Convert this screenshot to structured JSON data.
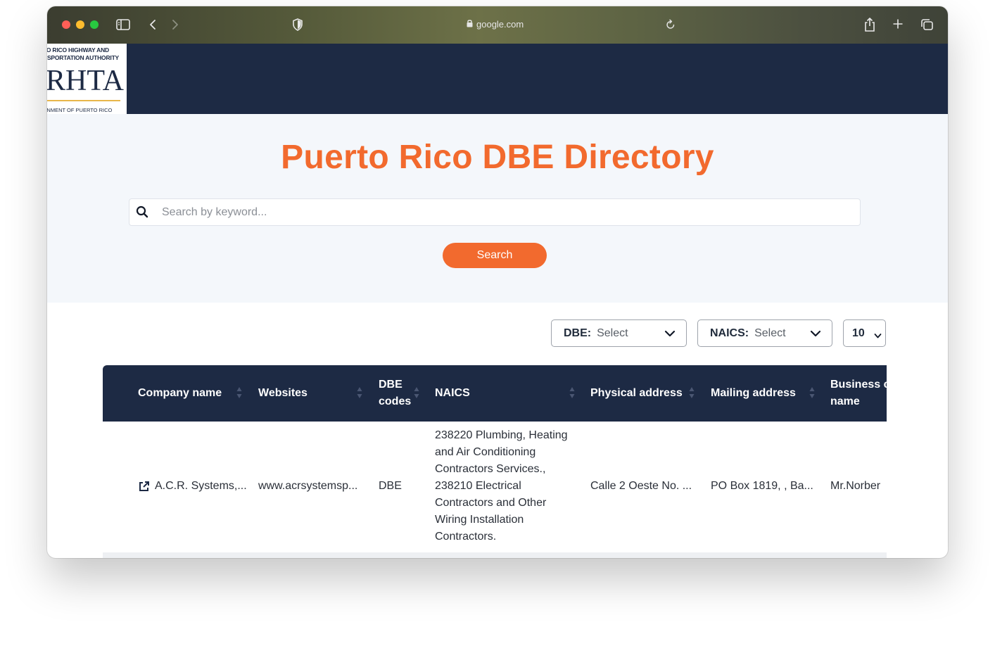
{
  "browser": {
    "url": "google.com"
  },
  "header": {
    "logo": {
      "top_line_1": "TO RICO HIGHWAY AND",
      "top_line_2": "NSPORTATION AUTHORITY",
      "main": "RHTA",
      "bottom": "RNMENT OF PUERTO RICO"
    }
  },
  "hero": {
    "title": "Puerto Rico DBE Directory",
    "search_placeholder": "Search by keyword...",
    "search_button": "Search"
  },
  "filters": {
    "dbe": {
      "label": "DBE:",
      "value": "Select"
    },
    "naics": {
      "label": "NAICS:",
      "value": "Select"
    },
    "page_size": "10"
  },
  "table": {
    "columns": [
      {
        "line1": "Company name",
        "line2": ""
      },
      {
        "line1": "Websites",
        "line2": ""
      },
      {
        "line1": "DBE",
        "line2": "codes"
      },
      {
        "line1": "NAICS",
        "line2": ""
      },
      {
        "line1": "Physical address",
        "line2": ""
      },
      {
        "line1": "Mailing address",
        "line2": ""
      },
      {
        "line1": "Business c",
        "line2": "name"
      }
    ],
    "rows": [
      {
        "company": "A.C.R. Systems,...",
        "website": "www.acrsystemsp...",
        "dbe_code": "DBE",
        "naics": "238220 Plumbing, Heating and Air Conditioning Contractors Services., 238210 Electrical Contractors and Other Wiring Installation Contractors.",
        "physical_address": "Calle 2 Oeste No. ...",
        "mailing_address": "PO Box 1819, , Ba...",
        "business_contact": "Mr.Norber"
      }
    ]
  },
  "colors": {
    "navy": "#1d2a44",
    "accent_orange": "#f26a2e",
    "hero_bg": "#f4f7fb"
  }
}
